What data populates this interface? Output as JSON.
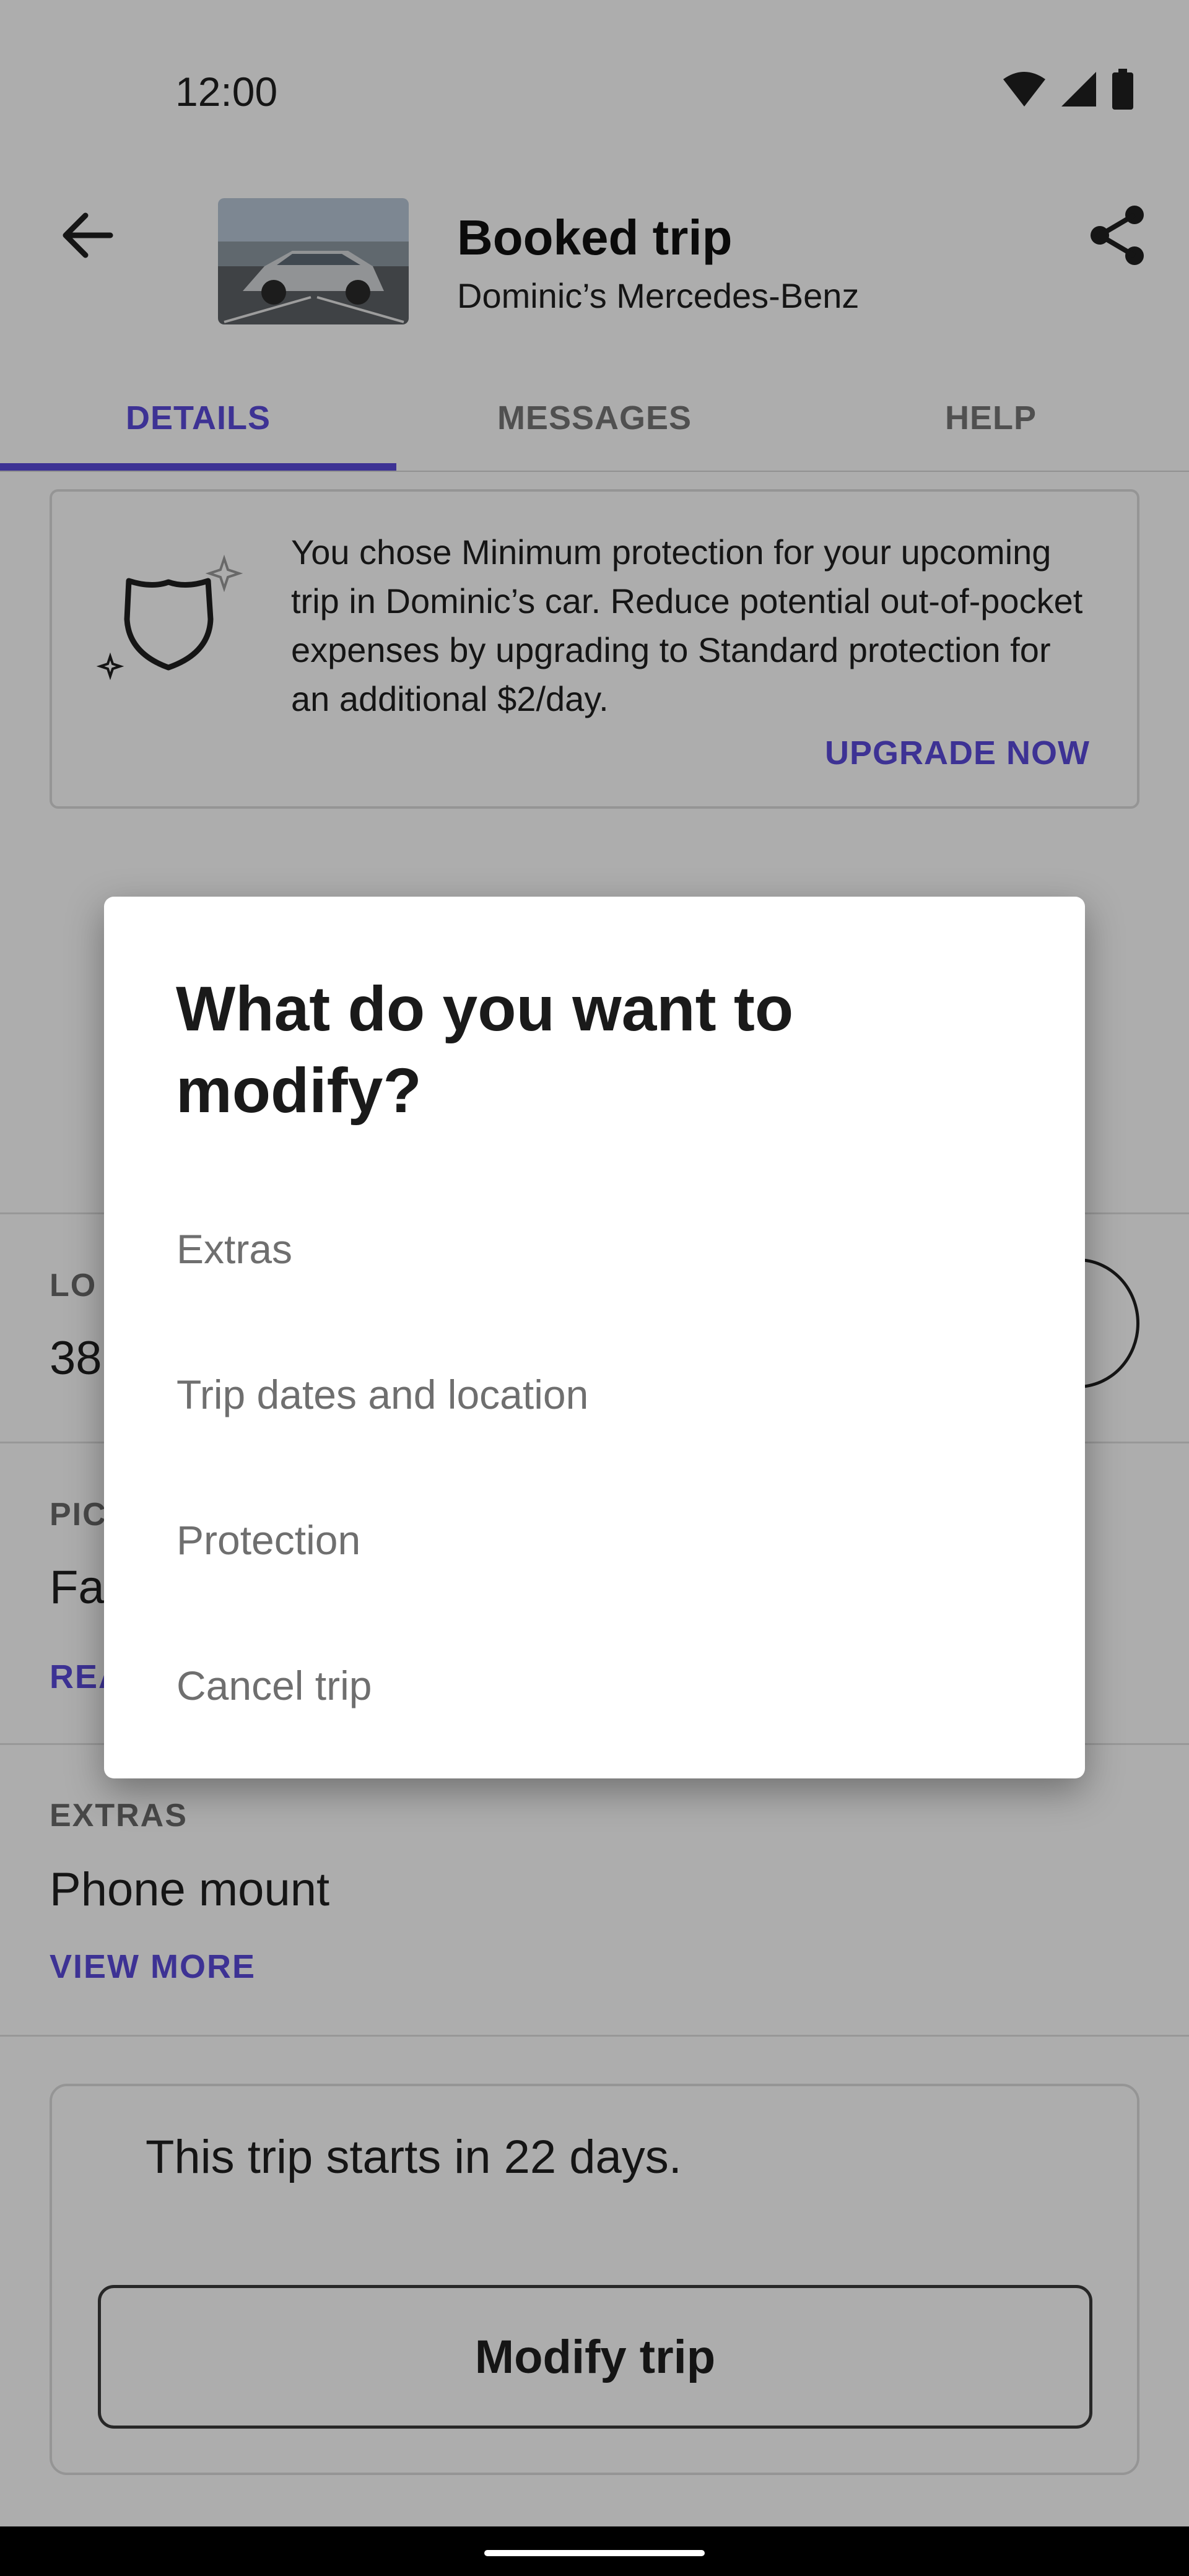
{
  "status_bar": {
    "time": "12:00"
  },
  "header": {
    "title": "Booked trip",
    "subtitle": "Dominic’s Mercedes-Benz"
  },
  "tabs": [
    {
      "label": "DETAILS",
      "active": true
    },
    {
      "label": "MESSAGES",
      "active": false
    },
    {
      "label": "HELP",
      "active": false
    }
  ],
  "protection_card": {
    "message": "You chose Minimum protection for your upcoming trip in Dominic’s car. Reduce potential out-of-pocket expenses by upgrading to Standard protection for an additional $2/day.",
    "action": "UPGRADE NOW"
  },
  "background_sections": {
    "location": {
      "label_fragment": "LO",
      "value_fragment": "38"
    },
    "pickup": {
      "label_fragment": "PIC",
      "value_fragment": "Fa",
      "link_fragment": "REA"
    },
    "extras": {
      "label": "EXTRAS",
      "value": "Phone mount",
      "link": "VIEW MORE"
    }
  },
  "trip_card": {
    "message": "This trip starts in 22 days.",
    "button": "Modify trip"
  },
  "dialog": {
    "title": "What do you want to modify?",
    "options": [
      "Extras",
      "Trip dates and location",
      "Protection",
      "Cancel trip"
    ]
  },
  "colors": {
    "accent": "#5b4bdb",
    "scrim": "rgba(0,0,0,0.32)",
    "text_primary": "#1f1f1f",
    "text_secondary": "#6f6f6f"
  }
}
